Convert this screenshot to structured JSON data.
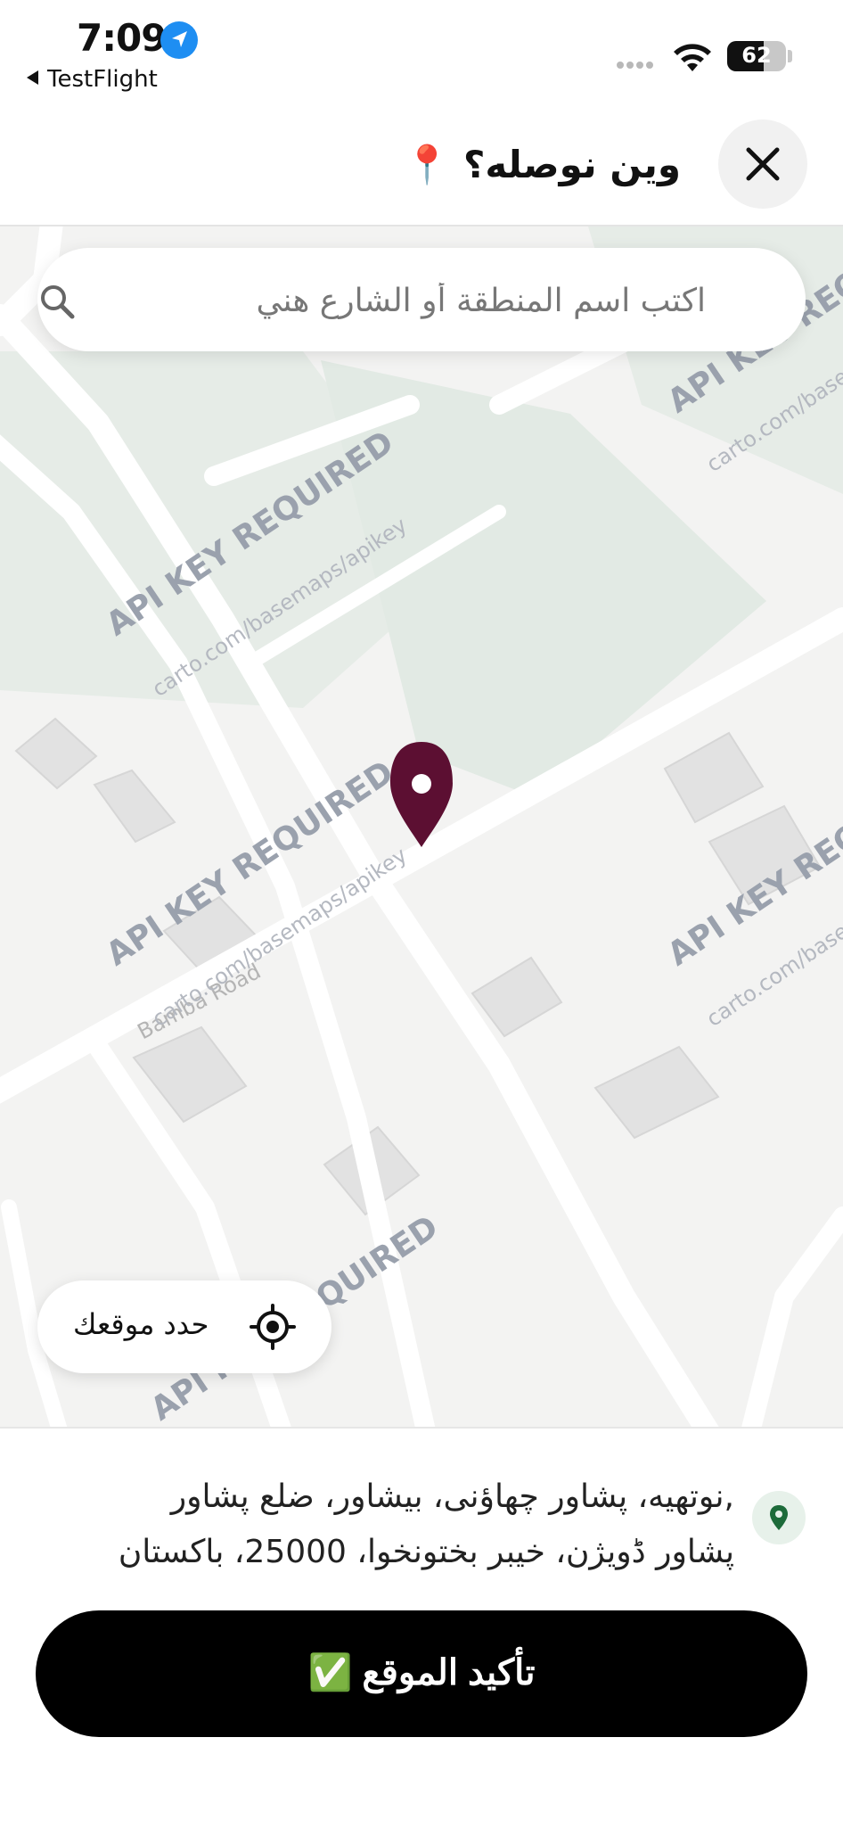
{
  "status_bar": {
    "time": "7:09",
    "back_app": "TestFlight",
    "battery": "62"
  },
  "header": {
    "title": "وين نوصله؟ 📍",
    "close_icon": "close-icon"
  },
  "search": {
    "placeholder": "اكتب اسم المنطقة أو الشارع هني",
    "icon": "search-icon"
  },
  "map": {
    "watermark_main": "API KEY REQUIRED",
    "watermark_url": "carto.com/basemaps/apikey",
    "road_label": "Bamba Road",
    "pin_color": "#5c0f32"
  },
  "locate_button": {
    "label": "حدد موقعك",
    "icon": "crosshair-icon"
  },
  "address": {
    "line1": ",نوتهيه، پشاور چهاؤنی، بیشاور، ضلع پشاور",
    "line2": "پشاور ڈویژن، خیبر بختونخوا، 25000، باکستان",
    "icon_color": "#1d6b3a"
  },
  "confirm_button": {
    "label": "تأكيد الموقع ✅"
  }
}
